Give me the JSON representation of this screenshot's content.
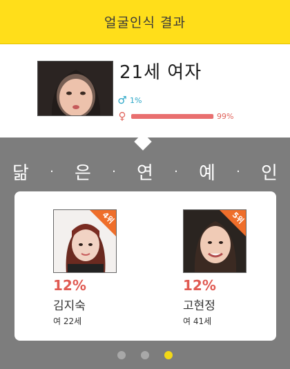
{
  "header": {
    "title": "얼굴인식 결과"
  },
  "result": {
    "age_gender": "21세 여자",
    "male_pct": "1%",
    "female_pct": "99%",
    "female_fraction": 0.99
  },
  "section": {
    "letters": [
      "닮",
      "은",
      "연",
      "예",
      "인"
    ],
    "separator": "·"
  },
  "celebs": [
    {
      "rank": "4위",
      "pct": "12%",
      "name": "김지숙",
      "meta": "여 22세"
    },
    {
      "rank": "5위",
      "pct": "12%",
      "name": "고현정",
      "meta": "여 41세"
    }
  ],
  "pager": {
    "count": 3,
    "active": 2
  },
  "colors": {
    "header": "#ffde1a",
    "female": "#e96f6f",
    "male": "#2aa6c7",
    "rank": "#ef6e2a"
  }
}
